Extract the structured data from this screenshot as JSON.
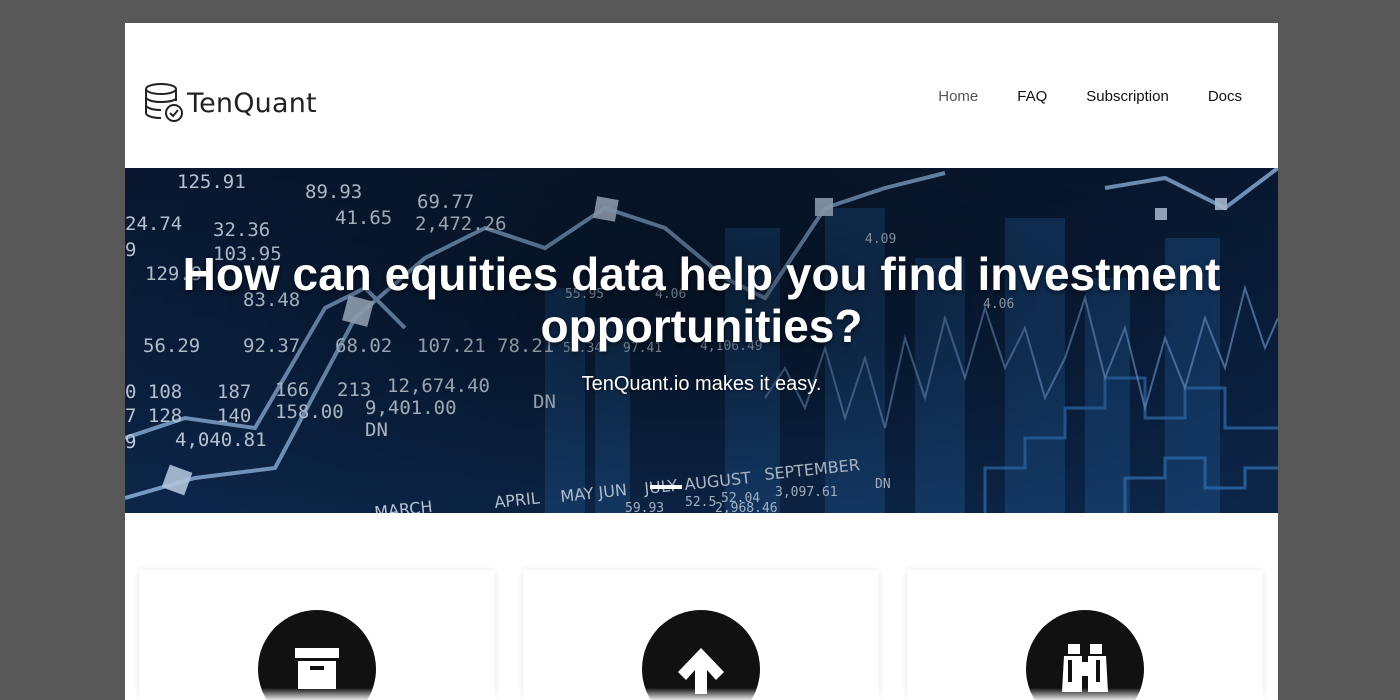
{
  "brand": {
    "name": "TenQuant",
    "logo_icon": "database-check-icon"
  },
  "nav": {
    "items": [
      {
        "label": "Home",
        "active": true
      },
      {
        "label": "FAQ",
        "active": false
      },
      {
        "label": "Subscription",
        "active": false
      },
      {
        "label": "Docs",
        "active": false
      }
    ]
  },
  "hero": {
    "title": "How can equities data help you find investment opportunities?",
    "subtitle": "TenQuant.io makes it easy.",
    "background_numbers": [
      "125.91",
      "89.93",
      "69.77",
      "24.74",
      "32.36",
      "41.65",
      "2,472.26",
      "103.95",
      "129.9",
      "83.48",
      "56.29",
      "92.37",
      "68.02",
      "107.21",
      "78.21",
      "58.34",
      "97.41",
      "4,106.49",
      "108",
      "187",
      "166",
      "213",
      "12,674.40",
      "128",
      "140",
      "158.00",
      "9,401.00",
      "4,040.81",
      "DN",
      "DN",
      "APRIL",
      "MAY",
      "JUN",
      "JULY",
      "AUGUST",
      "SEPTEMBER",
      "MARCH",
      "52.5",
      "52.04",
      "3,097.61",
      "59.93",
      "2,968.46",
      "4.06",
      "4.09"
    ]
  },
  "features": {
    "cards": [
      {
        "icon": "archive-box-icon"
      },
      {
        "icon": "arrow-up-icon"
      },
      {
        "icon": "binoculars-icon"
      }
    ]
  },
  "colors": {
    "window_frame": "#575757",
    "page_bg": "#ffffff",
    "hero_bg": "#0b2142",
    "icon_circle": "#111111",
    "text_dark": "#111111",
    "nav_active": "#555555"
  }
}
